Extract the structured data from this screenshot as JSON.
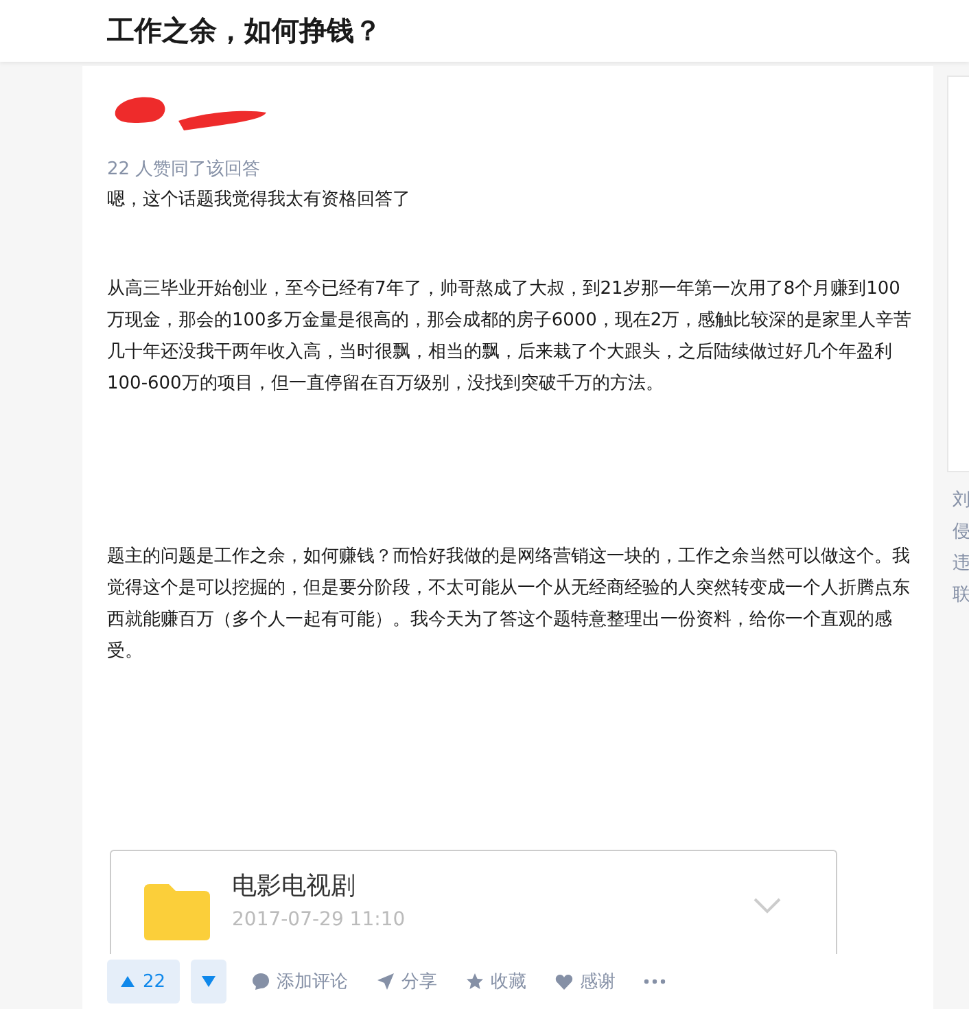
{
  "question": {
    "title": "工作之余，如何挣钱？"
  },
  "answer": {
    "vote_summary": "22 人赞同了该回答",
    "intro": "嗯，这个话题我觉得我太有资格回答了",
    "paragraphs": [
      "从高三毕业开始创业，至今已经有7年了，帅哥熬成了大叔，到21岁那一年第一次用了8个月赚到100万现金，那会的100多万金量是很高的，那会成都的房子6000，现在2万，感触比较深的是家里人辛苦几十年还没我干两年收入高，当时很飘，相当的飘，后来栽了个大跟头，之后陆续做过好几个年盈利100-600万的项目，但一直停留在百万级别，没找到突破千万的方法。",
      "题主的问题是工作之余，如何赚钱？而恰好我做的是网络营销这一块的，工作之余当然可以做这个。我觉得这个是可以挖掘的，但是要分阶段，不太可能从一个从无经商经验的人突然转变成一个人折腾点东西就能赚百万（多个人一起有可能）。我今天为了答这个题特意整理出一份资料，给你一个直观的感受。"
    ],
    "attachment": {
      "name": "电影电视剧",
      "date": "2017-07-29 11:10"
    }
  },
  "actions": {
    "upvote": "22",
    "items": [
      {
        "kind": "comment",
        "label": "添加评论"
      },
      {
        "kind": "share",
        "label": "分享"
      },
      {
        "kind": "favorite",
        "label": "收藏"
      },
      {
        "kind": "thanks",
        "label": "感谢"
      }
    ]
  },
  "sidebar": {
    "cut_text": [
      "刘",
      "侵",
      "违",
      "联"
    ]
  }
}
